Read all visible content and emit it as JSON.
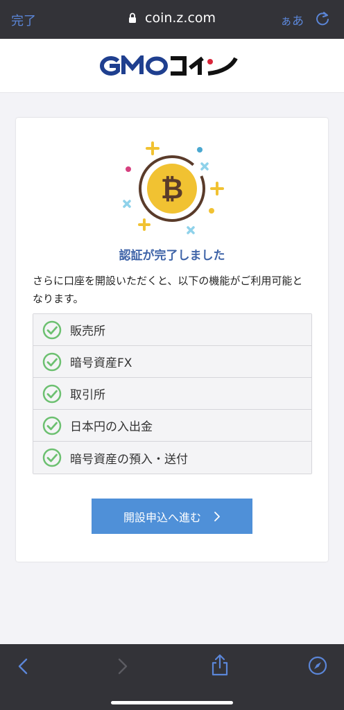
{
  "browser": {
    "done_label": "完了",
    "url": "coin.z.com",
    "aa_label": "ぁあ"
  },
  "brand": {
    "logo_text": "GMOコイン"
  },
  "card": {
    "title": "認証が完了しました",
    "description": "さらに口座を開設いただくと、以下の機能がご利用可能となります。",
    "features": [
      {
        "label": "販売所"
      },
      {
        "label": "暗号資産FX"
      },
      {
        "label": "取引所"
      },
      {
        "label": "日本円の入出金"
      },
      {
        "label": "暗号資産の預入・送付"
      }
    ],
    "apply_button_label": "開設申込へ進む"
  },
  "colors": {
    "accent": "#4f90d8",
    "title": "#3f64a8",
    "check": "#6cc070",
    "coin": "#f1c232"
  },
  "icons": {
    "lock": "lock-icon",
    "reload": "reload-icon",
    "back": "back-icon",
    "forward": "forward-icon",
    "share": "share-icon",
    "compass": "compass-icon",
    "check": "check-circle-icon",
    "bitcoin": "bitcoin-icon",
    "chevron": "chevron-right-icon"
  }
}
